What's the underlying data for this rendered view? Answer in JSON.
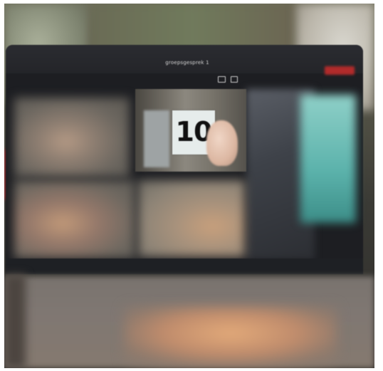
{
  "window": {
    "title": "groepsgesprek 1"
  },
  "video_tiles": {
    "card_number": "10"
  },
  "colors": {
    "accent_red": "#b12b2b",
    "tile_teal": "#5bb2ab"
  },
  "icons": [
    "share-screen-icon",
    "chat-icon"
  ]
}
